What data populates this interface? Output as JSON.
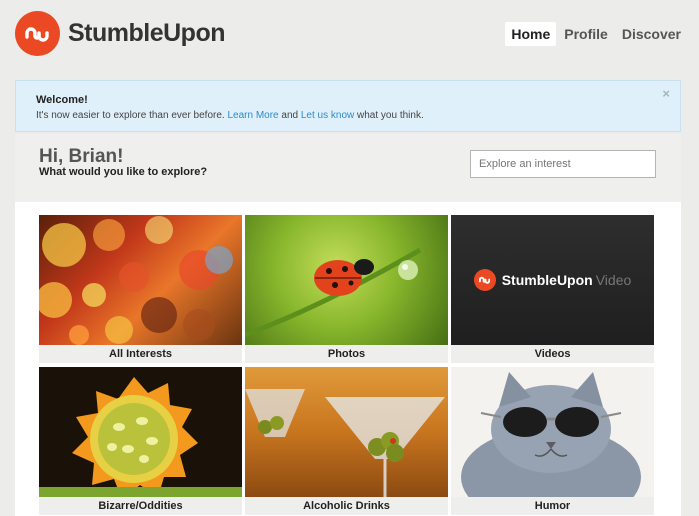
{
  "brand": {
    "name": "StumbleUpon",
    "color": "#eb4924",
    "icon": "stumbleupon-logo-icon"
  },
  "nav": {
    "items": [
      "Home",
      "Profile",
      "Discover"
    ],
    "active": "Home"
  },
  "welcome": {
    "title": "Welcome!",
    "msg_prefix": "It's now easier to explore than ever before.",
    "learn_more": "Learn More",
    "and": "and",
    "let_us_know": "Let us know",
    "msg_suffix": "what you think.",
    "close": "×"
  },
  "hero": {
    "greeting": "Hi, Brian!",
    "question": "What would you like to explore?",
    "search_placeholder": "Explore an interest"
  },
  "tiles": [
    {
      "label": "All Interests"
    },
    {
      "label": "Photos"
    },
    {
      "label": "Videos",
      "video_brand": "StumbleUpon",
      "video_word": "Video"
    },
    {
      "label": "Bizarre/Oddities"
    },
    {
      "label": "Alcoholic Drinks"
    },
    {
      "label": "Humor"
    }
  ]
}
